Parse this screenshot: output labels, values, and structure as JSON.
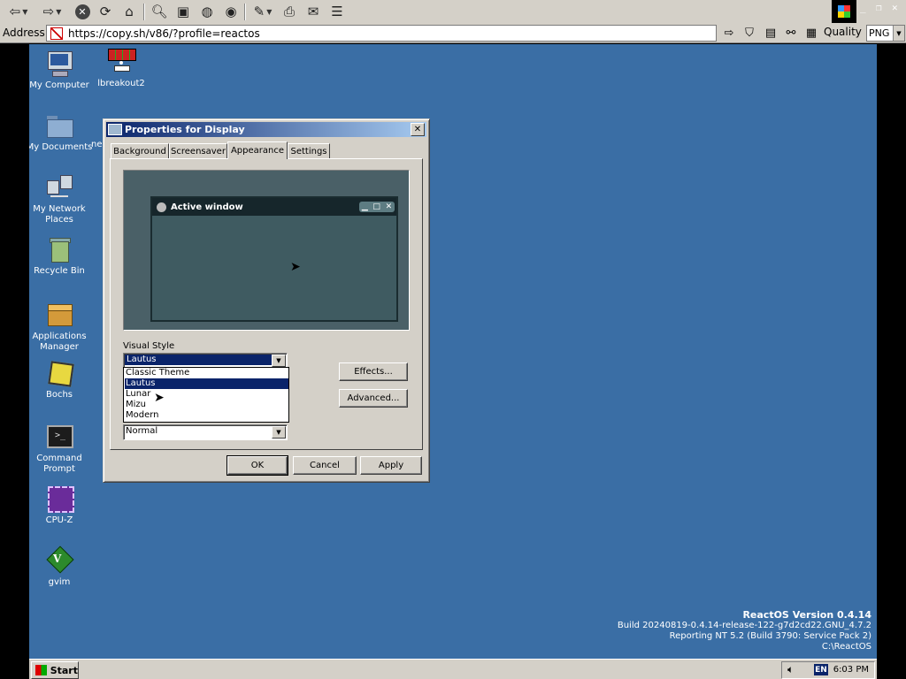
{
  "browser": {
    "address_label": "Address",
    "url": "https://copy.sh/v86/?profile=reactos",
    "quality_label": "Quality",
    "format": "PNG"
  },
  "desktop": {
    "icons": [
      {
        "label": "My Computer",
        "icon": "computer-icon"
      },
      {
        "label": "lbreakout2",
        "icon": "game-icon"
      },
      {
        "label": "My Documents",
        "icon": "folder-icon"
      },
      {
        "label": "My Network Places",
        "icon": "network-icon"
      },
      {
        "label": "Recycle Bin",
        "icon": "recycle-bin-icon"
      },
      {
        "label": "Applications Manager",
        "icon": "box-icon"
      },
      {
        "label": "Bochs",
        "icon": "bochs-icon"
      },
      {
        "label": "Command Prompt",
        "icon": "terminal-icon"
      },
      {
        "label": "CPU-Z",
        "icon": "chip-icon"
      },
      {
        "label": "gvim",
        "icon": "vim-icon"
      }
    ],
    "partial_label": "ne",
    "version": {
      "title": "ReactOS Version 0.4.14",
      "build": "Build 20240819-0.4.14-release-122-g7d2cd22.GNU_4.7.2",
      "reporting": "Reporting NT 5.2 (Build 3790: Service Pack 2)",
      "path": "C:\\ReactOS"
    }
  },
  "taskbar": {
    "start_label": "Start",
    "lang": "EN",
    "clock": "6:03 PM"
  },
  "dialog": {
    "title": "Properties for Display",
    "close": "✕",
    "tabs": [
      "Background",
      "Screensaver",
      "Appearance",
      "Settings"
    ],
    "active_tab": "Appearance",
    "preview_window_title": "Active window",
    "visual_style_label": "Visual Style",
    "visual_style_value": "Lautus",
    "options": [
      "Classic Theme",
      "Lautus",
      "Lunar",
      "Mizu",
      "Modern"
    ],
    "highlighted_option": "Lautus",
    "size_value": "Normal",
    "effects_button": "Effects...",
    "advanced_button": "Advanced...",
    "ok_button": "OK",
    "cancel_button": "Cancel",
    "apply_button": "Apply"
  }
}
